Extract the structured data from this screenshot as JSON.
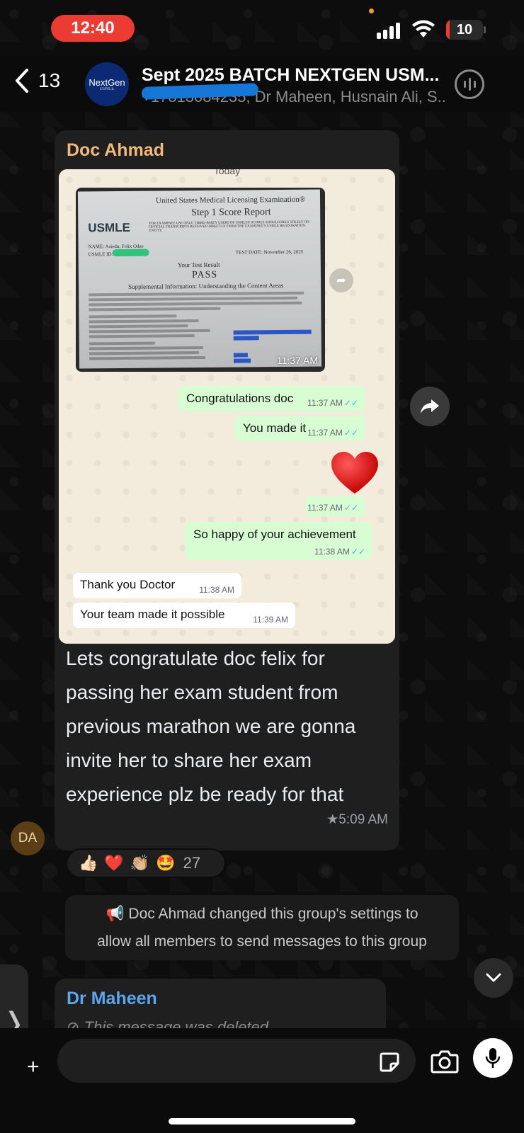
{
  "status_bar": {
    "time": "12:40",
    "battery_level": "10",
    "battery_fraction": 0.1
  },
  "header": {
    "back_count": "13",
    "group_title": "Sept 2025 BATCH NEXTGEN USM...",
    "members_text": "+17813084235, Dr Maheen, Husnain Ali, S...",
    "avatar_text": "NextGen",
    "avatar_subtext": "USMLE"
  },
  "message": {
    "sender": "Doc Ahmad",
    "image": {
      "date_stub": "Today",
      "score_report": {
        "org_line": "United States Medical Licensing Examination®",
        "report_title": "Step 1 Score Report",
        "logo": "USMLE",
        "fine_print": "FOR EXAMINEE USE ONLY. THIRD-PARTY USERS OF USMLE® SCORES SHOULD RELY SOLELY ON OFFICIAL TRANSCRIPTS RECEIVED DIRECTLY FROM THE EXAMINEE'S USMLE REGISTRATION ENTITY.",
        "name_line": "NAME: Asiedu, Felix Odae",
        "id_label": "USMLE ID:",
        "test_date": "TEST DATE: November 26, 2025",
        "result_label": "Your Test Result",
        "result": "PASS",
        "supplemental": "Supplemental Information: Understanding the Content Areas"
      },
      "photo_time": "11:37 AM",
      "bubbles": [
        {
          "dir": "out",
          "text": "Congratulations doc",
          "time": "11:37 AM"
        },
        {
          "dir": "out",
          "text": "You made it",
          "time": "11:37 AM"
        },
        {
          "dir": "out",
          "text": "",
          "time": "11:37 AM"
        },
        {
          "dir": "out",
          "text": "So happy of your achievement",
          "time": "11:38 AM"
        },
        {
          "dir": "in",
          "text": "Thank you Doctor",
          "time": "11:38 AM"
        },
        {
          "dir": "in",
          "text": "Your team made it possible",
          "time": "11:39 AM"
        }
      ],
      "ticks": "✓✓"
    },
    "caption": "Lets congratulate doc felix for passing her exam student from previous marathon we are gonna invite her to share her exam experience plz be ready for that",
    "time": "★5:09 AM",
    "sender_initials": "DA"
  },
  "reactions": {
    "emojis": [
      "👍🏻",
      "❤️",
      "👏🏼",
      "🤩"
    ],
    "count": "27"
  },
  "system_message": {
    "icon": "megaphone-icon",
    "line1": "📢 Doc Ahmad changed this group's settings to",
    "line2": "allow all members to send messages to this group"
  },
  "next_message": {
    "sender": "Dr Maheen",
    "text": "⊘ This message was deleted"
  },
  "side_tab": {
    "glyph": "❭"
  },
  "input": {
    "placeholder": ""
  },
  "colors": {
    "sender_name": "#f2b77a",
    "next_sender_name": "#5aa7ee",
    "time_pill": "#ec3b32",
    "outgoing_bubble": "#d9fdd3",
    "tick_blue": "#34b7f1"
  }
}
